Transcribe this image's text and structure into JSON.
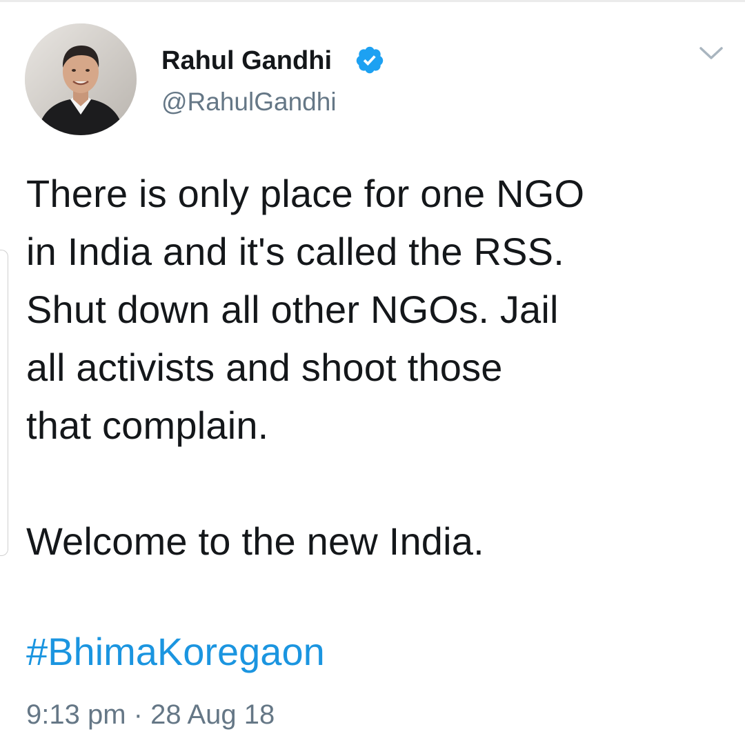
{
  "author": {
    "display_name": "Rahul Gandhi",
    "handle": "@RahulGandhi",
    "verified": true,
    "verified_icon": "verified-badge-icon",
    "avatar_icon": "profile-photo"
  },
  "menu": {
    "icon": "chevron-down-icon"
  },
  "tweet": {
    "text_main": "There is only place for one NGO\nin India and it's called the RSS.\nShut down all other NGOs. Jail\nall activists and shoot those\nthat complain.",
    "text_closing": "Welcome to the new India.",
    "hashtag": "#BhimaKoregaon",
    "timestamp": "9:13 pm · 28 Aug 18"
  },
  "colors": {
    "text": "#14171a",
    "secondary": "#657786",
    "link": "#1b95e0",
    "verified": "#1da1f2"
  }
}
